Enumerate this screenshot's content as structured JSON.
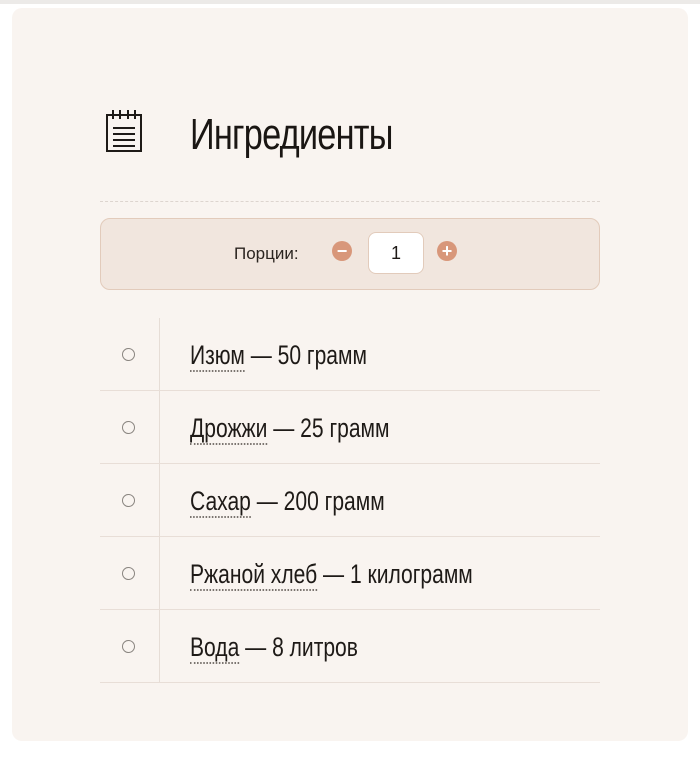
{
  "title": "Ингредиенты",
  "servings": {
    "label": "Порции:",
    "value": "1",
    "minus_symbol": "−",
    "plus_symbol": "+"
  },
  "ingredients": [
    {
      "name": "Изюм",
      "amount": "— 50 грамм"
    },
    {
      "name": "Дрожжи",
      "amount": "— 25 грамм"
    },
    {
      "name": "Сахар",
      "amount": "— 200 грамм"
    },
    {
      "name": "Ржаной хлеб",
      "amount": "— 1 килограмм"
    },
    {
      "name": "Вода",
      "amount": "— 8 литров"
    }
  ],
  "colors": {
    "card_bg": "#f9f4f0",
    "servings_bg": "#f1e6de",
    "accent": "#d8977a"
  },
  "icons": {
    "title": "notepad-icon",
    "decrease": "minus-circle-icon",
    "increase": "plus-circle-icon",
    "check": "radio-circle-icon"
  }
}
